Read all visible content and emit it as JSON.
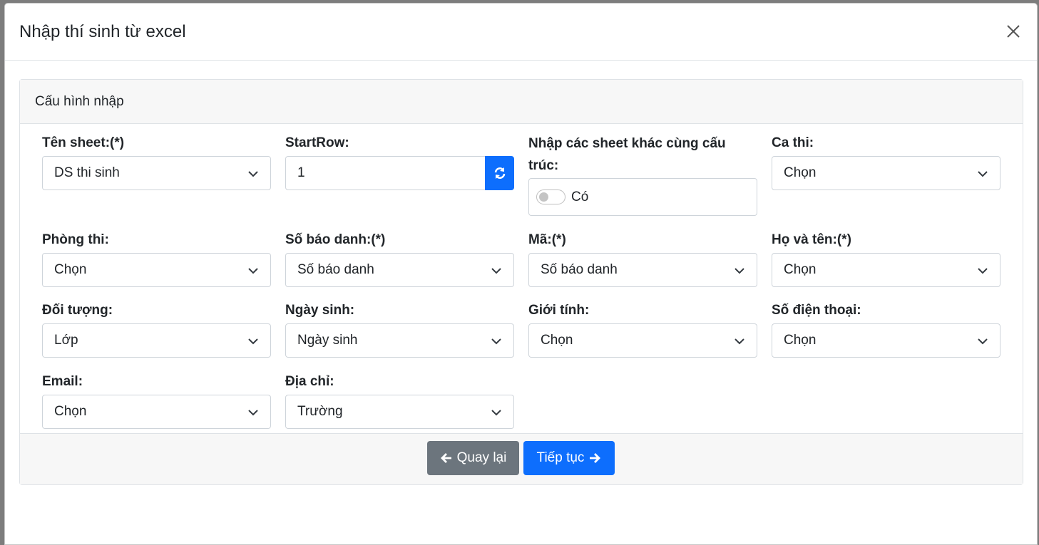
{
  "modal": {
    "title": "Nhập thí sinh từ excel",
    "close_icon": "close-icon"
  },
  "card": {
    "header": "Cấu hình nhập"
  },
  "fields": {
    "ten_sheet": {
      "label": "Tên sheet:(*)",
      "value": "DS thi sinh"
    },
    "start_row": {
      "label": "StartRow:",
      "value": "1",
      "button_icon": "refresh-icon"
    },
    "nhap_sheet": {
      "label": "Nhập các sheet khác cùng cấu trúc:",
      "toggle_label": "Có",
      "toggle_on": false
    },
    "ca_thi": {
      "label": "Ca thi:",
      "value": "Chọn"
    },
    "phong_thi": {
      "label": "Phòng thi:",
      "value": "Chọn"
    },
    "so_bao_danh": {
      "label": "Số báo danh:(*)",
      "value": "Số báo danh"
    },
    "ma": {
      "label": "Mã:(*)",
      "value": "Số báo danh"
    },
    "ho_ten": {
      "label": "Họ và tên:(*)",
      "value": "Chọn"
    },
    "doi_tuong": {
      "label": "Đối tượng:",
      "value": "Lớp"
    },
    "ngay_sinh": {
      "label": "Ngày sinh:",
      "value": "Ngày sinh"
    },
    "gioi_tinh": {
      "label": "Giới tính:",
      "value": "Chọn"
    },
    "so_dien_thoai": {
      "label": "Số điện thoại:",
      "value": "Chọn"
    },
    "email": {
      "label": "Email:",
      "value": "Chọn"
    },
    "dia_chi": {
      "label": "Địa chỉ:",
      "value": "Trường"
    }
  },
  "footer": {
    "back_label": "Quay lại",
    "next_label": "Tiếp tục"
  },
  "colors": {
    "primary": "#0d6efd",
    "secondary": "#6c757d"
  }
}
